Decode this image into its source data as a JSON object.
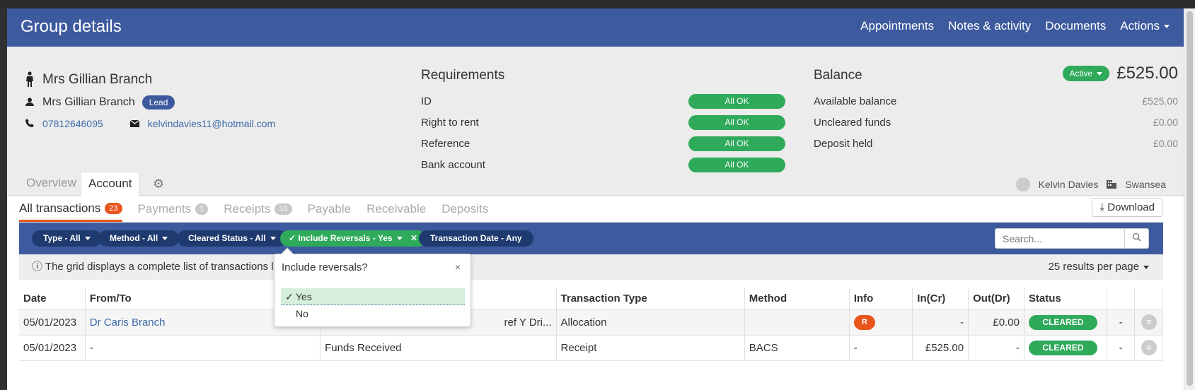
{
  "header": {
    "title": "Group details",
    "nav": [
      "Appointments",
      "Notes & activity",
      "Documents",
      "Actions"
    ]
  },
  "person": {
    "name": "Mrs Gillian Branch",
    "contact_name": "Mrs Gillian Branch",
    "lead_badge": "Lead",
    "phone": "07812646095",
    "email": "kelvindavies11@hotmail.com"
  },
  "requirements": {
    "title": "Requirements",
    "items": [
      {
        "label": "ID",
        "status": "All OK"
      },
      {
        "label": "Right to rent",
        "status": "All OK"
      },
      {
        "label": "Reference",
        "status": "All OK"
      },
      {
        "label": "Bank account",
        "status": "All OK"
      }
    ]
  },
  "balance": {
    "title": "Balance",
    "status": "Active",
    "amount": "£525.00",
    "items": [
      {
        "label": "Available balance",
        "value": "£525.00"
      },
      {
        "label": "Uncleared funds",
        "value": "£0.00"
      },
      {
        "label": "Deposit held",
        "value": "£0.00"
      }
    ]
  },
  "tabs": {
    "overview": "Overview",
    "account": "Account",
    "user": "Kelvin Davies",
    "branch": "Swansea"
  },
  "subtabs": {
    "all": {
      "label": "All transactions",
      "count": "23"
    },
    "payments": {
      "label": "Payments",
      "count": "1"
    },
    "receipts": {
      "label": "Receipts",
      "count": "10"
    },
    "payable": "Payable",
    "receivable": "Receivable",
    "deposits": "Deposits",
    "download": "Download"
  },
  "filters": {
    "type": "Type - All",
    "method": "Method - All",
    "cleared": "Cleared Status - All",
    "reversals": "Include Reversals - Yes",
    "date": "Transaction Date - Any",
    "search_placeholder": "Search..."
  },
  "infobar": {
    "text": "The grid displays a complete list of transactions linked",
    "per_page": "25 results per page"
  },
  "popover": {
    "title": "Include reversals?",
    "close": "×",
    "options": [
      "Yes",
      "No"
    ]
  },
  "table": {
    "headers": [
      "Date",
      "From/To",
      "",
      "Transaction Type",
      "Method",
      "Info",
      "In(Cr)",
      "Out(Dr)",
      "Status",
      "",
      ""
    ],
    "rows": [
      {
        "date": "05/01/2023",
        "from": "Dr Caris Branch",
        "desc": "ref Y Dri...",
        "type": "Allocation",
        "method": "",
        "info": "R",
        "in": "-",
        "out": "£0.00",
        "status": "CLEARED",
        "dash": "-"
      },
      {
        "date": "05/01/2023",
        "from": "-",
        "desc": "Funds Received",
        "type": "Receipt",
        "method": "BACS",
        "info": "-",
        "in": "£525.00",
        "out": "-",
        "status": "CLEARED",
        "dash": "-"
      }
    ]
  }
}
